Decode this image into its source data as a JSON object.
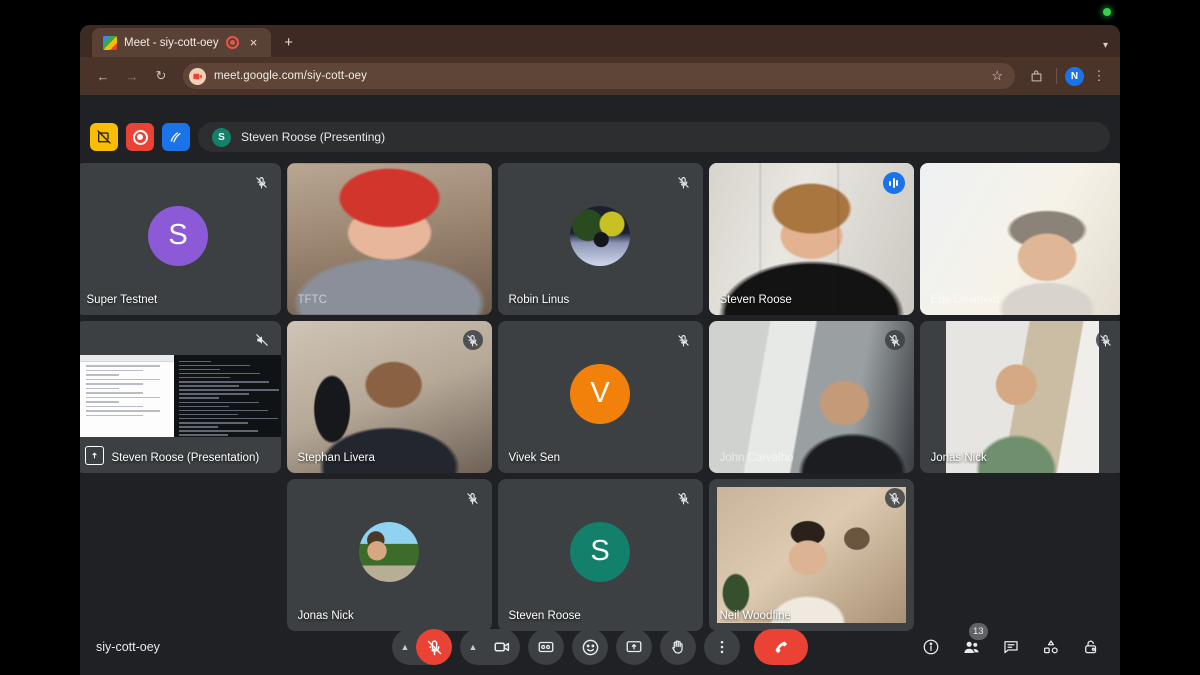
{
  "browser": {
    "tab": {
      "title": "Meet - siy-cott-oey",
      "favicon": "google-meet-favicon",
      "recording_icon": "tab-recording-icon",
      "close_label": "×"
    },
    "new_tab_label": "+",
    "tab_list_chevron": "▾",
    "nav": {
      "back": "←",
      "forward": "→",
      "reload": "↻"
    },
    "url": "meet.google.com/siy-cott-oey",
    "bookmark_icon": "☆",
    "profile_initial": "N",
    "menu_icon": "⋮"
  },
  "banner": {
    "stop_presenting_icon": "stop-presenting-icon",
    "record_icon": "record-icon",
    "annotate_icon": "annotate-pen-icon",
    "avatar_initial": "S",
    "text": "Steven Roose (Presenting)"
  },
  "grid": {
    "rows": [
      [
        {
          "name": "Super Testnet",
          "kind": "avatar-letter",
          "initial": "S",
          "avatar_color": "#8c5ad6",
          "muted": true,
          "name_faded": false
        },
        {
          "name": "TFTC",
          "kind": "video",
          "media": "vid-tftc",
          "muted": false,
          "name_faded": true
        },
        {
          "name": "Robin Linus",
          "kind": "avatar-photo",
          "photo": "ph-robin",
          "muted": true,
          "name_faded": false
        },
        {
          "name": "Steven Roose",
          "kind": "video",
          "media": "vid-steven",
          "speaking": true,
          "active": true,
          "name_faded": false
        },
        {
          "name": "Erik Desmedt",
          "kind": "video",
          "media": "vid-erik",
          "muted": false,
          "name_faded": true
        }
      ],
      [
        {
          "name": "Steven Roose (Presentation)",
          "kind": "presentation",
          "muted": true,
          "present_icon": "present-screen-icon",
          "name_faded": false
        },
        {
          "name": "Stephan Livera",
          "kind": "video",
          "media": "vid-stephan",
          "muted": true,
          "name_faded": false
        },
        {
          "name": "Vivek Sen",
          "kind": "avatar-letter",
          "initial": "V",
          "avatar_color": "#f2810c",
          "muted": true,
          "name_faded": false
        },
        {
          "name": "John Carvalho",
          "kind": "video",
          "media": "vid-john",
          "muted": true,
          "name_faded": true
        },
        {
          "name": "Jonas Nick",
          "kind": "video",
          "media": "vid-jonas2",
          "muted": true,
          "name_faded": false
        }
      ],
      [
        {
          "name": "Jonas Nick",
          "kind": "avatar-photo",
          "photo": "ph-jonas",
          "muted": true,
          "name_faded": false
        },
        {
          "name": "Steven Roose",
          "kind": "avatar-letter",
          "initial": "S",
          "avatar_color": "#12806a",
          "muted": true,
          "name_faded": false
        },
        {
          "name": "Neil Woodfine",
          "kind": "video",
          "media": "vid-neil",
          "muted": true,
          "name_faded": false
        }
      ]
    ]
  },
  "bottom": {
    "meeting_code": "siy-cott-oey",
    "controls": [
      {
        "id": "microphone",
        "label": "Microphone (muted)",
        "icon": "mic-off-icon",
        "state": "muted"
      },
      {
        "id": "camera",
        "label": "Camera",
        "icon": "camera-icon",
        "state": "on"
      },
      {
        "id": "captions",
        "label": "Turn on captions",
        "icon": "closed-captions-icon"
      },
      {
        "id": "reactions",
        "label": "Send a reaction",
        "icon": "emoji-smile-icon"
      },
      {
        "id": "present",
        "label": "Present now",
        "icon": "present-now-icon"
      },
      {
        "id": "raise-hand",
        "label": "Raise hand",
        "icon": "raise-hand-icon"
      },
      {
        "id": "more-options",
        "label": "More options",
        "icon": "more-vertical-icon"
      },
      {
        "id": "leave-call",
        "label": "Leave call",
        "icon": "end-call-icon"
      }
    ],
    "right_controls": [
      {
        "id": "meeting-details",
        "label": "Meeting details",
        "icon": "info-icon"
      },
      {
        "id": "people",
        "label": "People",
        "icon": "people-icon",
        "badge": "13"
      },
      {
        "id": "chat",
        "label": "Chat with everyone",
        "icon": "chat-icon"
      },
      {
        "id": "activities",
        "label": "Activities",
        "icon": "activities-icon"
      },
      {
        "id": "host-controls",
        "label": "Host controls",
        "icon": "host-lock-icon"
      }
    ]
  },
  "desktop": {
    "camera_indicator": "camera-in-use-indicator"
  }
}
